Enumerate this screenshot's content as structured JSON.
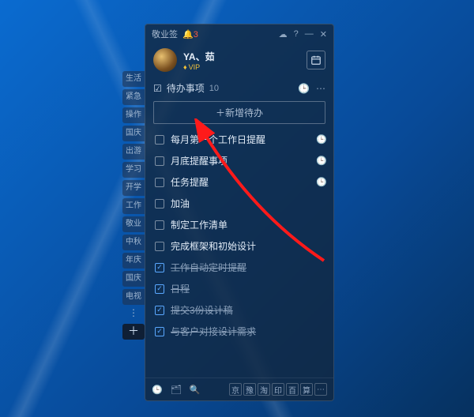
{
  "titlebar": {
    "app_name": "敬业签",
    "notif_count": "3",
    "cloud_icon": "☁",
    "help_icon": "?",
    "min_icon": "—",
    "close_icon": "✕"
  },
  "user": {
    "name": "YA、茹",
    "vip_label": "VIP",
    "calendar_icon": "📅"
  },
  "section": {
    "icon": "☑",
    "title": "待办事项",
    "count": "10",
    "clock_icon": "🕒",
    "more_icon": "⋯"
  },
  "add_button": "＋新增待办",
  "todos": [
    {
      "text": "每月第一个工作日提醒",
      "done": false,
      "has_clock": true
    },
    {
      "text": "月底提醒事项",
      "done": false,
      "has_clock": true
    },
    {
      "text": "任务提醒",
      "done": false,
      "has_clock": true
    },
    {
      "text": "加油",
      "done": false,
      "has_clock": false
    },
    {
      "text": "制定工作清单",
      "done": false,
      "has_clock": false
    },
    {
      "text": "完成框架和初始设计",
      "done": false,
      "has_clock": false
    },
    {
      "text": "工作自动定时提醒",
      "done": true,
      "has_clock": false
    },
    {
      "text": "日程",
      "done": true,
      "has_clock": false
    },
    {
      "text": "提交3份设计稿",
      "done": true,
      "has_clock": false
    },
    {
      "text": "与客户对接设计需求",
      "done": true,
      "has_clock": false
    }
  ],
  "footer": {
    "left_icons": [
      "🕒",
      "🗂",
      "🔍"
    ],
    "right_chips": [
      "京",
      "豫",
      "淘",
      "印",
      "百",
      "算"
    ],
    "right_more": "⋯"
  },
  "side_tags": [
    "生活",
    "紧急",
    "操作",
    "国庆",
    "出游",
    "学习",
    "开学",
    "工作",
    "敬业",
    "中秋",
    "年庆",
    "国庆",
    "电视"
  ],
  "side_dots": "⋮",
  "side_add": "＋",
  "clock_glyph": "🕒",
  "check_glyph": "✓"
}
